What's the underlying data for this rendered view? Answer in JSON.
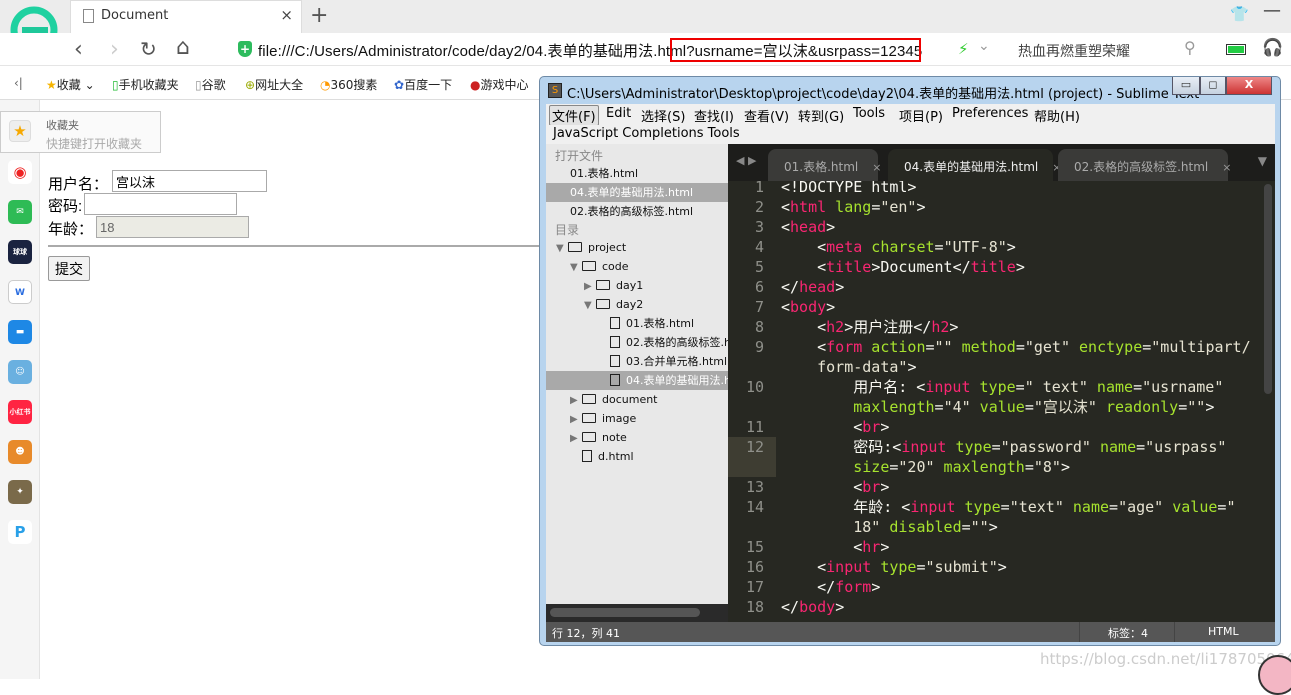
{
  "browser": {
    "tab_title": "Document",
    "tab_close": "×",
    "new_tab": "+",
    "url": "file:///C:/Users/Administrator/code/day2/04.表单的基础用法.html?usrname=宫以沫&usrpass=12345",
    "search_hint": "热血再燃重塑荣耀",
    "nav": {
      "back": "‹",
      "forward": "›",
      "reload": "↻",
      "home": "⌂"
    },
    "bookmarks": [
      "收藏",
      "手机收藏夹",
      "谷歌",
      "网址大全",
      "360搜素",
      "百度一下",
      "游戏中心"
    ],
    "fav_tip": {
      "title": "收藏夹",
      "hint": "快捷键打开收藏夹"
    },
    "sidebar_apps": [
      "weibo-icon",
      "mail-icon",
      "news-icon",
      "word-icon",
      "chat-icon",
      "game-icon",
      "xiaohongshu-icon",
      "game2-icon",
      "pubg-icon",
      "p-icon"
    ],
    "accent": "#2dbb5d"
  },
  "page": {
    "username_label": "用户名：",
    "username_value": "宫以沫",
    "password_label": "密码:",
    "password_value": "",
    "age_label": "年龄：",
    "age_value": "18",
    "submit": "提交"
  },
  "watermark": "https://blog.csdn.net/li1787050645",
  "sublime": {
    "title": "C:\\Users\\Administrator\\Desktop\\project\\code\\day2\\04.表单的基础用法.html (project) - Sublime Text",
    "menu": [
      "文件(F)",
      "Edit",
      "选择(S)",
      "查找(I)",
      "查看(V)",
      "转到(G)",
      "Tools",
      "项目(P)",
      "Preferences",
      "帮助(H)"
    ],
    "menu2": [
      "JavaScript Completions Tools"
    ],
    "open_files_header": "打开文件",
    "open_files": [
      "01.表格.html",
      "04.表单的基础用法.html",
      "02.表格的高级标签.html"
    ],
    "dir_header": "目录",
    "tree": [
      {
        "label": "project",
        "depth": 0,
        "type": "folder-open"
      },
      {
        "label": "code",
        "depth": 1,
        "type": "folder-open"
      },
      {
        "label": "day1",
        "depth": 2,
        "type": "folder"
      },
      {
        "label": "day2",
        "depth": 2,
        "type": "folder-open"
      },
      {
        "label": "01.表格.html",
        "depth": 3,
        "type": "file"
      },
      {
        "label": "02.表格的高级标签.html",
        "depth": 3,
        "type": "file"
      },
      {
        "label": "03.合并单元格.html",
        "depth": 3,
        "type": "file"
      },
      {
        "label": "04.表单的基础用法.html",
        "depth": 3,
        "type": "file",
        "selected": true
      },
      {
        "label": "document",
        "depth": 1,
        "type": "folder"
      },
      {
        "label": "image",
        "depth": 1,
        "type": "folder"
      },
      {
        "label": "note",
        "depth": 1,
        "type": "folder"
      },
      {
        "label": "d.html",
        "depth": 1,
        "type": "file"
      }
    ],
    "tabs": [
      {
        "label": "01.表格.html"
      },
      {
        "label": "04.表单的基础用法.html",
        "active": true
      },
      {
        "label": "02.表格的高级标签.html"
      }
    ],
    "code": [
      {
        "n": "1",
        "rows": [
          [
            [
              "p",
              "<!DOCTYPE html>"
            ]
          ]
        ]
      },
      {
        "n": "2",
        "rows": [
          [
            [
              "p",
              "<"
            ],
            [
              "t",
              "html"
            ],
            [
              "a",
              " lang"
            ],
            [
              "p",
              "="
            ],
            [
              "s",
              "\"en\""
            ],
            [
              "p",
              ">"
            ]
          ]
        ]
      },
      {
        "n": "3",
        "rows": [
          [
            [
              "p",
              "<"
            ],
            [
              "t",
              "head"
            ],
            [
              "p",
              ">"
            ]
          ]
        ]
      },
      {
        "n": "4",
        "rows": [
          [
            [
              "p",
              "    <"
            ],
            [
              "t",
              "meta"
            ],
            [
              "a",
              " charset"
            ],
            [
              "p",
              "="
            ],
            [
              "s",
              "\"UTF-8\""
            ],
            [
              "p",
              ">"
            ]
          ]
        ]
      },
      {
        "n": "5",
        "rows": [
          [
            [
              "p",
              "    <"
            ],
            [
              "t",
              "title"
            ],
            [
              "p",
              ">Document</"
            ],
            [
              "t",
              "title"
            ],
            [
              "p",
              ">"
            ]
          ]
        ]
      },
      {
        "n": "6",
        "rows": [
          [
            [
              "p",
              "</"
            ],
            [
              "t",
              "head"
            ],
            [
              "p",
              ">"
            ]
          ]
        ]
      },
      {
        "n": "7",
        "rows": [
          [
            [
              "p",
              "<"
            ],
            [
              "t",
              "body"
            ],
            [
              "p",
              ">"
            ]
          ]
        ]
      },
      {
        "n": "8",
        "rows": [
          [
            [
              "p",
              "    <"
            ],
            [
              "t",
              "h2"
            ],
            [
              "p",
              ">用户注册</"
            ],
            [
              "t",
              "h2"
            ],
            [
              "p",
              ">"
            ]
          ]
        ]
      },
      {
        "n": "9",
        "rows": [
          [
            [
              "p",
              "    <"
            ],
            [
              "t",
              "form"
            ],
            [
              "a",
              " action"
            ],
            [
              "p",
              "="
            ],
            [
              "s",
              "\"\""
            ],
            [
              "a",
              " method"
            ],
            [
              "p",
              "="
            ],
            [
              "s",
              "\"get\""
            ],
            [
              "a",
              " enctype"
            ],
            [
              "p",
              "="
            ],
            [
              "s",
              "\"multipart/"
            ]
          ],
          [
            [
              "s",
              "    form-data\""
            ],
            [
              "p",
              ">"
            ]
          ]
        ]
      },
      {
        "n": "10",
        "rows": [
          [
            [
              "p",
              "        用户名: <"
            ],
            [
              "t",
              "input"
            ],
            [
              "a",
              " type"
            ],
            [
              "p",
              "="
            ],
            [
              "s",
              "\" text\""
            ],
            [
              "a",
              " name"
            ],
            [
              "p",
              "="
            ],
            [
              "s",
              "\"usrname\""
            ]
          ],
          [
            [
              "a",
              "        maxlength"
            ],
            [
              "p",
              "="
            ],
            [
              "s",
              "\"4\""
            ],
            [
              "a",
              " value"
            ],
            [
              "p",
              "="
            ],
            [
              "s",
              "\"宫以沫\""
            ],
            [
              "a",
              " readonly"
            ],
            [
              "p",
              "="
            ],
            [
              "s",
              "\"\""
            ],
            [
              "p",
              ">"
            ]
          ]
        ]
      },
      {
        "n": "11",
        "rows": [
          [
            [
              "p",
              "        <"
            ],
            [
              "t",
              "br"
            ],
            [
              "p",
              ">"
            ]
          ]
        ]
      },
      {
        "n": "12",
        "hl": true,
        "rows": [
          [
            [
              "p",
              "        密码:<"
            ],
            [
              "t",
              "input"
            ],
            [
              "a",
              " type"
            ],
            [
              "p",
              "="
            ],
            [
              "s",
              "\"password\""
            ],
            [
              "a",
              " name"
            ],
            [
              "p",
              "="
            ],
            [
              "s",
              "\"usrpass\""
            ]
          ],
          [
            [
              "a",
              "        size"
            ],
            [
              "p",
              "="
            ],
            [
              "s",
              "\"20\""
            ],
            [
              "a",
              " maxlength"
            ],
            [
              "p",
              "="
            ],
            [
              "s",
              "\"8\""
            ],
            [
              "p",
              ">"
            ]
          ]
        ]
      },
      {
        "n": "13",
        "rows": [
          [
            [
              "p",
              "        <"
            ],
            [
              "t",
              "br"
            ],
            [
              "p",
              ">"
            ]
          ]
        ]
      },
      {
        "n": "14",
        "rows": [
          [
            [
              "p",
              "        年龄: <"
            ],
            [
              "t",
              "input"
            ],
            [
              "a",
              " type"
            ],
            [
              "p",
              "="
            ],
            [
              "s",
              "\"text\""
            ],
            [
              "a",
              " name"
            ],
            [
              "p",
              "="
            ],
            [
              "s",
              "\"age\""
            ],
            [
              "a",
              " value"
            ],
            [
              "p",
              "="
            ],
            [
              "s",
              "\""
            ]
          ],
          [
            [
              "s",
              "        18\""
            ],
            [
              "a",
              " disabled"
            ],
            [
              "p",
              "="
            ],
            [
              "s",
              "\"\""
            ],
            [
              "p",
              ">"
            ]
          ]
        ]
      },
      {
        "n": "15",
        "rows": [
          [
            [
              "p",
              "        <"
            ],
            [
              "t",
              "hr"
            ],
            [
              "p",
              ">"
            ]
          ]
        ]
      },
      {
        "n": "16",
        "rows": [
          [
            [
              "p",
              "    <"
            ],
            [
              "t",
              "input"
            ],
            [
              "a",
              " type"
            ],
            [
              "p",
              "="
            ],
            [
              "s",
              "\"submit\""
            ],
            [
              "p",
              ">"
            ]
          ]
        ]
      },
      {
        "n": "17",
        "rows": [
          [
            [
              "p",
              "    </"
            ],
            [
              "t",
              "form"
            ],
            [
              "p",
              ">"
            ]
          ]
        ]
      },
      {
        "n": "18",
        "rows": [
          [
            [
              "p",
              "</"
            ],
            [
              "t",
              "body"
            ],
            [
              "p",
              ">"
            ]
          ]
        ]
      }
    ],
    "status": {
      "position": "行 12，列 41",
      "tab_size": "标签：4",
      "syntax": "HTML"
    },
    "colors": {
      "tag": "#f92672",
      "attr": "#a6e22e",
      "bg": "#272822"
    }
  }
}
